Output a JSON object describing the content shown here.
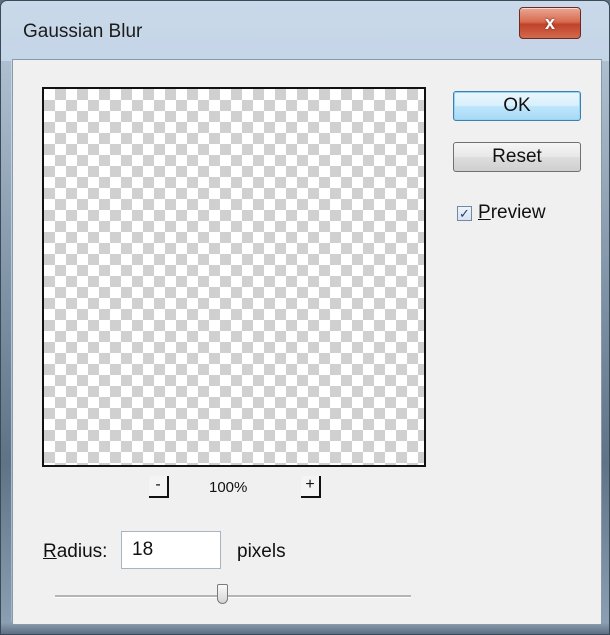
{
  "window": {
    "title": "Gaussian Blur",
    "close_glyph": "x"
  },
  "preview": {
    "zoom_out_label": "-",
    "zoom_in_label": "+",
    "zoom_level": "100%"
  },
  "buttons": {
    "ok": "OK",
    "reset": "Reset"
  },
  "preview_checkbox": {
    "checked": true,
    "check_glyph": "✓",
    "label_accel": "P",
    "label_rest": "review"
  },
  "radius": {
    "label_accel": "R",
    "label_rest": "adius:",
    "value": "18",
    "units": "pixels",
    "slider_fraction": 0.47
  },
  "colors": {
    "accent": "#3c7fb1",
    "close_button": "#c0432a"
  }
}
